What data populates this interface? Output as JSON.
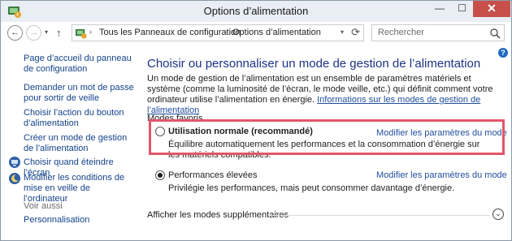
{
  "window": {
    "title": "Options d’alimentation",
    "minimize": "—",
    "maximize": "☐",
    "close": "✕"
  },
  "nav": {
    "back": "←",
    "forward": "→",
    "recent": "▾",
    "up": "↑",
    "address_segments": [
      "Tous les Panneaux de configuration",
      "Options d’alimentation"
    ],
    "separator": "›",
    "dropdown": "▾",
    "refresh": "⟳",
    "search_placeholder": "Rechercher"
  },
  "help_label": "?",
  "sidebar": {
    "items": [
      {
        "label": "Page d’accueil du panneau de configuration",
        "icon": null
      },
      {
        "label": "Demander un mot de passe pour sortir de veille",
        "icon": null
      },
      {
        "label": "Choisir l’action du bouton d’alimentation",
        "icon": null
      },
      {
        "label": "Créer un mode de gestion de l’alimentation",
        "icon": null
      },
      {
        "label": "Choisir quand éteindre l’écran",
        "icon": "monitor-icon"
      },
      {
        "label": "Modifier les conditions de mise en veille de l’ordinateur",
        "icon": "moon-icon"
      }
    ],
    "see_also_title": "Voir aussi",
    "see_also": [
      {
        "label": "Personnalisation"
      }
    ]
  },
  "main": {
    "heading": "Choisir ou personnaliser un mode de gestion de l’alimentation",
    "intro_text": "Un mode de gestion de l’alimentation est un ensemble de paramètres matériels et système (comme la luminosité de l’écran, le mode veille, etc.) qui définit comment votre ordinateur utilise l’alimentation en énergie. ",
    "intro_link": "Informations sur les modes de gestion de l’alimentation",
    "section_label": "Modes favoris",
    "plans": [
      {
        "name": "Utilisation normale (recommandé)",
        "selected": false,
        "link": "Modifier les paramètres du mode",
        "description": "Équilibre automatiquement les performances et la consommation d’énergie sur les matériels compatibles."
      },
      {
        "name": "Performances élevées",
        "selected": true,
        "link": "Modifier les paramètres du mode",
        "description": "Privilégie les performances, mais peut consommer davantage d’énergie."
      }
    ],
    "more_plans": "Afficher les modes supplémentaires",
    "expand_icon": "⌄"
  },
  "colors": {
    "highlight_border": "#e2566a",
    "heading": "#1e3287",
    "link": "#1f4e9e",
    "close_button": "#c7504a"
  }
}
